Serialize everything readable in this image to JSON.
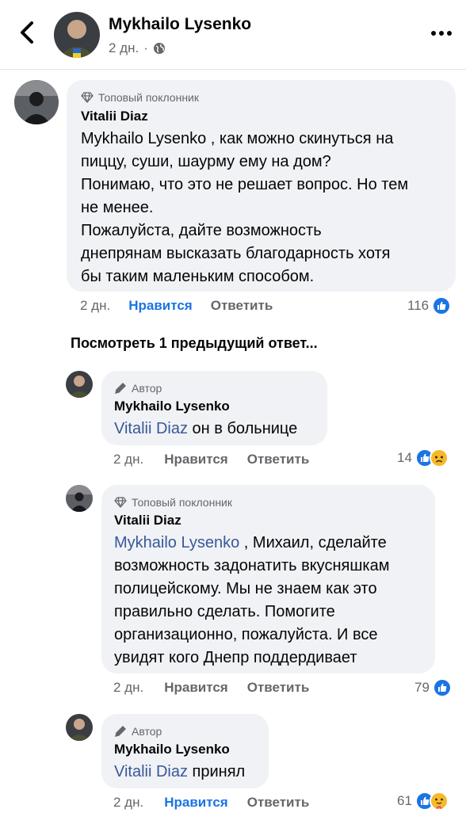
{
  "header": {
    "name": "Mykhailo Lysenko",
    "time": "2 дн.",
    "dot": "·",
    "back_icon": "chevron-left-icon",
    "privacy_icon": "globe-icon",
    "more_icon": "more-horizontal-icon"
  },
  "see_previous": "Посмотреть 1 предыдущий ответ...",
  "colors": {
    "link": "#385898",
    "like_active": "#1b74e4",
    "bubble": "#f0f2f5",
    "secondary": "#65676b"
  },
  "comments": [
    {
      "badge": "Топовый поклонник",
      "badge_icon": "diamond-icon",
      "author": "Vitalii Diaz",
      "lines": [
        "Mykhailo Lysenko , как можно скинуться на",
        "пиццу, суши, шаурму ему на дом?",
        "Понимаю, что это не решает вопрос. Но тем",
        "не менее.",
        "Пожалуйста, дайте возможность",
        "днепрянам высказать благодарность хотя",
        "бы таким маленьким способом."
      ],
      "time": "2 дн.",
      "like": "Нравится",
      "reply": "Ответить",
      "reactions": "116"
    },
    {
      "badge": "Автор",
      "badge_icon": "pen-icon",
      "author": "Mykhailo Lysenko",
      "mention": "Vitalii Diaz",
      "text": " он в больнице",
      "time": "2 дн.",
      "like": "Нравится",
      "reply": "Ответить",
      "reactions": "14"
    },
    {
      "badge": "Топовый поклонник",
      "badge_icon": "diamond-icon",
      "author": "Vitalii Diaz",
      "mention": "Mykhailo Lysenko",
      "first_rest": " , Михаил, сделайте",
      "lines": [
        "возможность задонатить вкусняшкам",
        "полицейскому. Мы не знаем как это",
        "правильно сделать. Помогите",
        "организационно, пожалуйста. И все",
        "увидят кого Днепр поддердивает"
      ],
      "time": "2 дн.",
      "like": "Нравится",
      "reply": "Ответить",
      "reactions": "79"
    },
    {
      "badge": "Автор",
      "badge_icon": "pen-icon",
      "author": "Mykhailo Lysenko",
      "mention": "Vitalii Diaz",
      "text": " принял",
      "time": "2 дн.",
      "like": "Нравится",
      "reply": "Ответить",
      "reactions": "61"
    }
  ]
}
